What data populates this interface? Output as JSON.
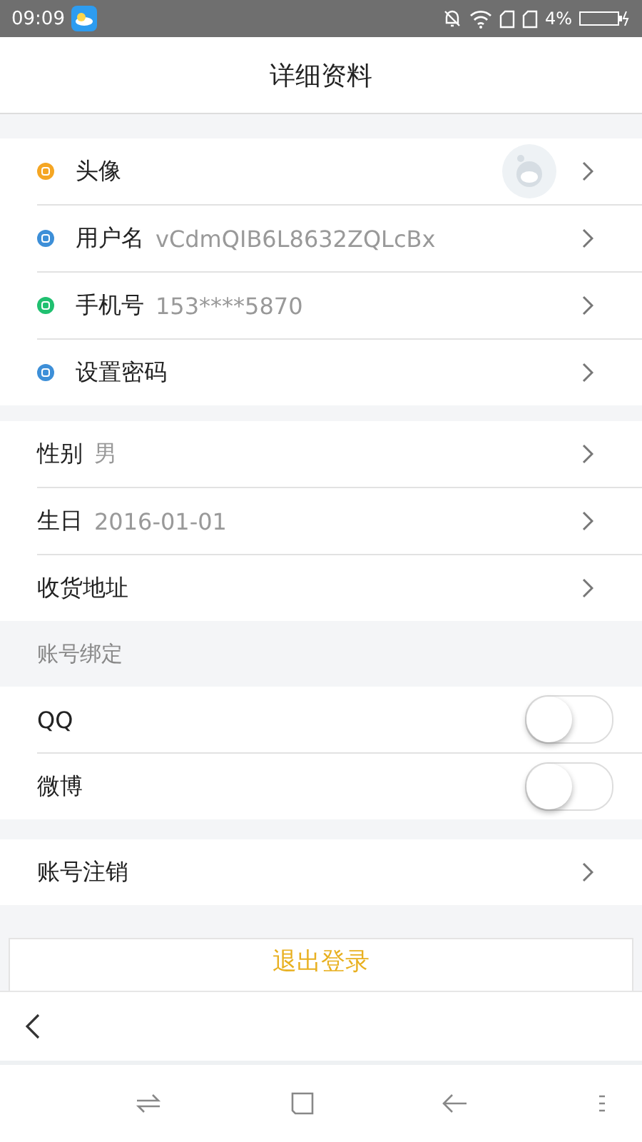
{
  "status_bar": {
    "time": "09:09",
    "battery": "4%"
  },
  "header": {
    "title": "详细资料"
  },
  "account_rows": [
    {
      "label": "头像",
      "value": "",
      "color": "#f5a623",
      "kind": "avatar"
    },
    {
      "label": "用户名",
      "value": "vCdmQIB6L8632ZQLcBx",
      "color": "#3d8fd8",
      "kind": "text"
    },
    {
      "label": "手机号",
      "value": "153****5870",
      "color": "#20c070",
      "kind": "text"
    },
    {
      "label": "设置密码",
      "value": "",
      "color": "#3d8fd8",
      "kind": "text"
    }
  ],
  "profile_rows": [
    {
      "label": "性别",
      "value": "男"
    },
    {
      "label": "生日",
      "value": "2016-01-01"
    },
    {
      "label": "收货地址",
      "value": ""
    }
  ],
  "binding": {
    "title": "账号绑定",
    "items": [
      {
        "label": "QQ",
        "on": false
      },
      {
        "label": "微博",
        "on": false
      }
    ]
  },
  "cancel_row": {
    "label": "账号注销"
  },
  "logout_button": "退出登录"
}
